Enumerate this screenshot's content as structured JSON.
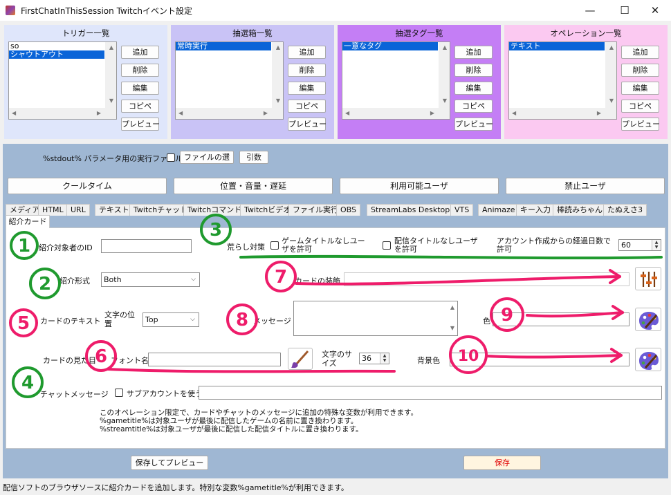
{
  "window": {
    "title": "FirstChatInThisSession Twitchイベント設定",
    "minimize_glyph": "—",
    "maximize_glyph": "☐",
    "close_glyph": "✕"
  },
  "panels": [
    {
      "title": "トリガー一覧",
      "color": "#dfe6fb",
      "items": [
        "so",
        "シャウトアウト"
      ],
      "selected": 1
    },
    {
      "title": "抽選箱一覧",
      "color": "#c9c3f6",
      "items": [
        "常時実行"
      ],
      "selected": 0
    },
    {
      "title": "抽選タグ一覧",
      "color": "#c47ef5",
      "items": [
        "一意なタグ"
      ],
      "selected": 0
    },
    {
      "title": "オペレーション一覧",
      "color": "#fbc9f1",
      "items": [
        "テキスト"
      ],
      "selected": 0
    }
  ],
  "panel_buttons": [
    "追加",
    "削除",
    "編集",
    "コピペ",
    "プレビュー"
  ],
  "stdout": {
    "label": "%stdout% パラメータ用の実行ファイルを使う",
    "file_button": "ファイルの選",
    "args_button": "引数"
  },
  "wide_buttons": [
    "クールタイム",
    "位置・音量・遅延",
    "利用可能ユーザ",
    "禁止ユーザ"
  ],
  "tabs": [
    "メディア",
    "HTML",
    "URL",
    "テキスト",
    "Twitchチャット",
    "Twitchコマンド",
    "Twitchビデオ",
    "ファイル実行",
    "OBS",
    "StreamLabs Desktop",
    "VTS",
    "Animaze",
    "キー入力",
    "棒読みちゃん",
    "たぬえさ3"
  ],
  "active_tab": "紹介カード",
  "form": {
    "target_id_label": "紹介対象者のID",
    "target_id_value": "",
    "troll_label": "荒らし対策",
    "no_game_title_label": "ゲームタイトルなしユーザを許可",
    "no_stream_title_label": "配信タイトルなしユーザを許可",
    "account_age_label": "アカウント作成からの経過日数で許可",
    "account_age_value": "60",
    "intro_format_label": "紹介形式",
    "intro_format_value": "Both",
    "card_decoration_label": "カードの装飾",
    "card_text_label": "カードのテキスト",
    "text_position_label": "文字の位置",
    "text_position_value": "Top",
    "message_label": "メッセージ",
    "color_label": "色",
    "card_look_label": "カードの見た目",
    "font_name_label": "フォント名",
    "font_size_label": "文字のサイズ",
    "font_size_value": "36",
    "bg_color_label": "背景色",
    "chat_message_label": "チャットメッセージ",
    "sub_account_label": "サブアカウントを使う",
    "info_lines": [
      "このオペレーション限定で、カードやチャットのメッセージに追加の特殊な変数が利用できます。",
      "%gametitle%は対象ユーザが最後に配信したゲームの名前に置き換わります。",
      "%streamtitle%は対象ユーザが最後に配信した配信タイトルに置き換わります。"
    ]
  },
  "bottom": {
    "save_preview": "保存してプレビュー",
    "save": "保存",
    "save_color": "#e00000"
  },
  "status": "配信ソフトのブラウザソースに紹介カードを追加します。特別な変数%gametitle%が利用できます。",
  "annotations": {
    "numbers": [
      "1",
      "2",
      "3",
      "4",
      "5",
      "6",
      "7",
      "8",
      "9",
      "10"
    ],
    "green": "#1f9a2e",
    "pink": "#ee1c6a"
  }
}
